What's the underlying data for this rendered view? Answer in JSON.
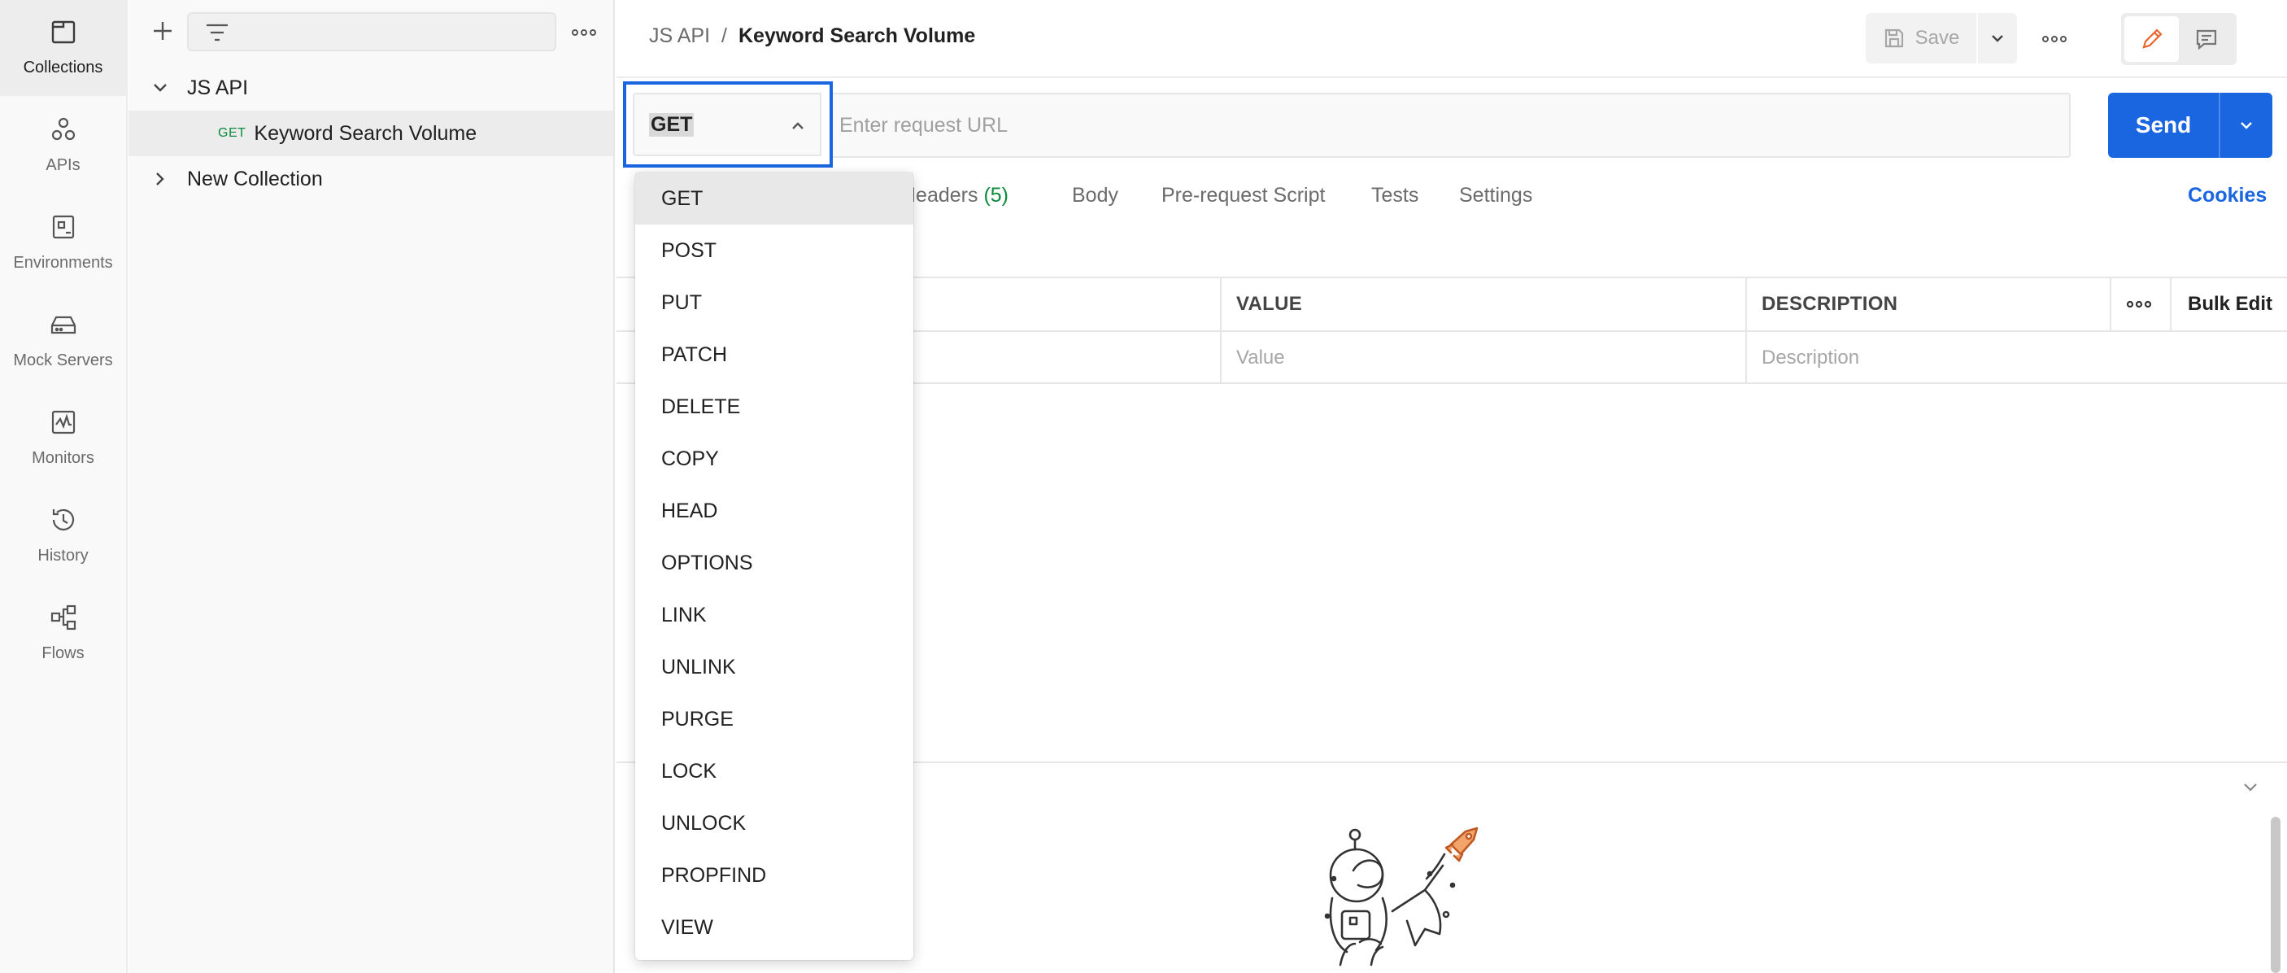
{
  "rail": {
    "items": [
      {
        "label": "Collections",
        "icon": "collections-icon"
      },
      {
        "label": "APIs",
        "icon": "apis-icon"
      },
      {
        "label": "Environments",
        "icon": "environments-icon"
      },
      {
        "label": "Mock Servers",
        "icon": "mock-servers-icon"
      },
      {
        "label": "Monitors",
        "icon": "monitors-icon"
      },
      {
        "label": "History",
        "icon": "history-icon"
      },
      {
        "label": "Flows",
        "icon": "flows-icon"
      }
    ]
  },
  "sidebar": {
    "tree": {
      "collection_1": "JS API",
      "request_method": "GET",
      "request_name": "Keyword Search Volume",
      "collection_2": "New Collection"
    }
  },
  "header": {
    "breadcrumb_parent": "JS API",
    "breadcrumb_sep": "/",
    "breadcrumb_current": "Keyword Search Volume",
    "save_label": "Save"
  },
  "request": {
    "method": "GET",
    "url_value": "",
    "url_placeholder": "Enter request URL",
    "send_label": "Send"
  },
  "tabs": {
    "headers": "Headers",
    "headers_count": "(5)",
    "body": "Body",
    "prerequest": "Pre-request Script",
    "tests": "Tests",
    "settings": "Settings",
    "cookies": "Cookies"
  },
  "params": {
    "col_value": "VALUE",
    "col_description": "DESCRIPTION",
    "bulk_edit": "Bulk Edit",
    "value_placeholder": "Value",
    "description_placeholder": "Description"
  },
  "method_dropdown": {
    "options": [
      "GET",
      "POST",
      "PUT",
      "PATCH",
      "DELETE",
      "COPY",
      "HEAD",
      "OPTIONS",
      "LINK",
      "UNLINK",
      "PURGE",
      "LOCK",
      "UNLOCK",
      "PROPFIND",
      "VIEW"
    ],
    "selected": "GET"
  },
  "colors": {
    "accent": "#1a66e0",
    "method_green": "#0a8a3a",
    "edit_orange": "#e8652c"
  }
}
